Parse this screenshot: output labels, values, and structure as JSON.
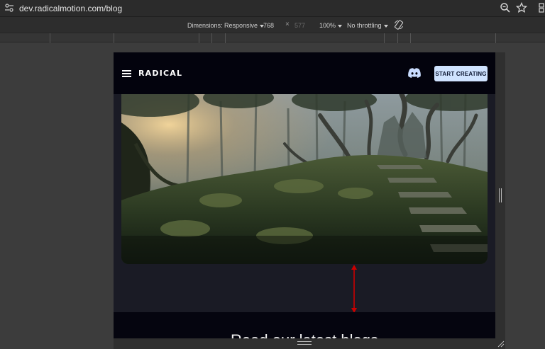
{
  "browser": {
    "url": "dev.radicalmotion.com/blog",
    "icons": [
      "site-settings-icon",
      "zoom-icon",
      "star-icon",
      "more-icon"
    ]
  },
  "device_toolbar": {
    "dimensions_label": "Dimensions: Responsive",
    "width": "768",
    "times": "×",
    "height": "577",
    "zoom": "100%",
    "throttling": "No throttling",
    "icons": [
      "rotate-icon",
      "caret-down-icon"
    ]
  },
  "site": {
    "brand": "RADICAL",
    "cta_label": "START CREATING",
    "icons": [
      "menu-icon",
      "discord-icon"
    ]
  },
  "hero": {
    "image": "forest-hillside-with-stone-stairs"
  },
  "annotation": {
    "color": "#cc0000",
    "icon": "double-arrow-vertical-icon"
  },
  "blog": {
    "heading": "Read our latest blogs"
  },
  "colors": {
    "cta_bg": "#cfe3ff",
    "header_bg": "#03030d",
    "page_bg": "#1a1b25",
    "discord": "#c9dcff"
  }
}
